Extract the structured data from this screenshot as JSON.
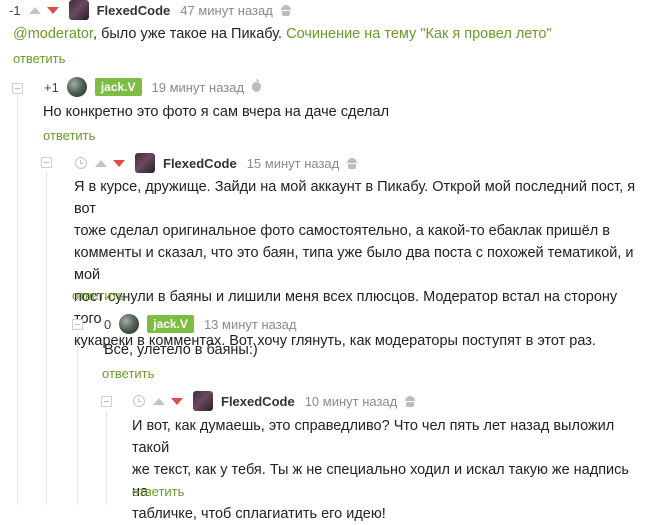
{
  "comments": [
    {
      "rating": "-1",
      "user": "FlexedCode",
      "time": "47 минут назад",
      "mention": "@moderator",
      "text_after_mention": ", было уже такое на Пикабу. ",
      "link_text": "Сочинение на тему \"Как я провел лето\"",
      "reply": "ответить"
    },
    {
      "rating": "+1",
      "user": "jack.V",
      "time": "19 минут назад",
      "text": "Но конкретно это фото я сам вчера на даче сделал",
      "reply": "ответить"
    },
    {
      "user": "FlexedCode",
      "time": "15 минут назад",
      "lines": [
        "Я в курсе, дружище. Зайди на мой аккаунт в Пикабу. Открой мой последний пост, я вот",
        "тоже сделал оригинальное фото самостоятельно, а какой-то ебаклак пришёл в",
        "комменты и сказал, что это баян, типа уже было два поста с похожей тематикой, и мой",
        "пост сунули в баяны и лишили меня всех плюсцов. Модератор встал на сторону того",
        "кукареки в комментах. Вот хочу глянуть, как модераторы поступят в этот раз."
      ],
      "reply": "ответить"
    },
    {
      "rating": "0",
      "user": "jack.V",
      "time": "13 минут назад",
      "text": "Всё, улетело в баяны:)",
      "reply": "ответить"
    },
    {
      "user": "FlexedCode",
      "time": "10 минут назад",
      "lines": [
        "И вот, как думаешь, это справедливо? Что чел пять лет назад выложил такой",
        "же текст, как у тебя. Ты ж не специально ходил и искал такую же надпись на",
        "табличке, чтоб сплагиатить его идею!"
      ],
      "reply": "ответить"
    }
  ],
  "icons": {
    "vote_up": "arrow-up-icon",
    "vote_down": "arrow-down-icon",
    "pending": "clock-icon",
    "android": "android-icon",
    "apple": "apple-icon",
    "collapse": "minus-square-icon"
  },
  "colors": {
    "link": "#6a9a2b",
    "badge": "#7cbd42",
    "downvote": "#e44a4a",
    "muted": "#8a8a8a"
  }
}
